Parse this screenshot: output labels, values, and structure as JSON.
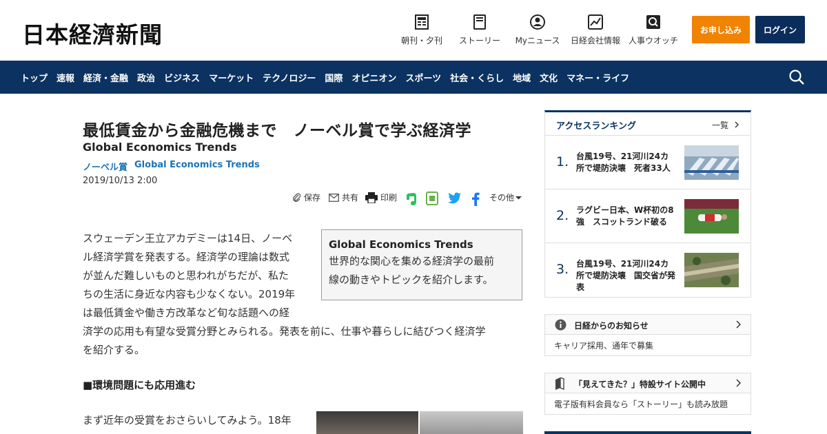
{
  "header": {
    "logo": "日本経濟新聞",
    "nav": [
      {
        "label": "朝刊・夕刊",
        "icon": "newspaper-icon"
      },
      {
        "label": "ストーリー",
        "icon": "book-icon"
      },
      {
        "label": "Myニュース",
        "icon": "user-icon"
      },
      {
        "label": "日経会社情報",
        "icon": "chart-icon"
      },
      {
        "label": "人事ウオッチ",
        "icon": "magnifier-icon"
      }
    ],
    "subscribe_label": "お申し込み",
    "login_label": "ログイン"
  },
  "navbar": {
    "items": [
      "トップ",
      "速報",
      "経済・金融",
      "政治",
      "ビジネス",
      "マーケット",
      "テクノロジー",
      "国際",
      "オピニオン",
      "スポーツ",
      "社会・くらし",
      "地域",
      "文化",
      "マネー・ライフ"
    ]
  },
  "article": {
    "title": "最低賃金から金融危機まで　ノーベル賞で学ぶ経済学",
    "subtitle": "Global Economics Trends",
    "tags": [
      "ノーベル賞",
      "Global Economics Trends"
    ],
    "date": "2019/10/13 2:00",
    "actions": {
      "save": "保存",
      "share": "共有",
      "print": "印刷",
      "more": "その他"
    },
    "box_title": "Global Economics Trends",
    "box_lines": [
      "世界的な関心を集める経済学の最前",
      "線の動きやトピックを紹介します。"
    ],
    "para_lines": [
      "スウェーデン王立アカデミーは14日、ノーベ",
      "ル経済学賞を発表する。経済学の理論は数式",
      "が並んだ難しいものと思われがちだが、私た",
      "ちの生活に身近な内容も少なくない。2019年",
      "は最低賃金や働き方改革など旬な話題への経",
      "済学の応用も有望な受賞分野とみられる。発表を前に、仕事や暮らしに結びつく経済学",
      "を紹介する。"
    ],
    "heading": "■環境問題にも応用進む",
    "para2": "まず近年の受賞をおさらいしてみよう。18年"
  },
  "ranking": {
    "title": "アクセスランキング",
    "more": "一覧",
    "items": [
      {
        "rank": "1.",
        "text": "台風19号、21河川24カ所で堤防決壊　死者33人"
      },
      {
        "rank": "2.",
        "text": "ラグビー日本、W杯初の8強　スコットランド破る"
      },
      {
        "rank": "3.",
        "text": "台風19号、21河川24カ所で堤防決壊　国交省が発表"
      }
    ]
  },
  "notices": [
    {
      "title": "日経からのお知らせ",
      "body": "キャリア採用、通年で募集",
      "icon": "info-icon"
    },
    {
      "title": "「見えてきた？」特設サイト公開中",
      "body": "電子版有料会員なら「ストーリー」も読み放題",
      "icon": "book-icon"
    }
  ],
  "colors": {
    "navy": "#0b3261",
    "orange": "#f08300",
    "link": "#1b73b8"
  }
}
